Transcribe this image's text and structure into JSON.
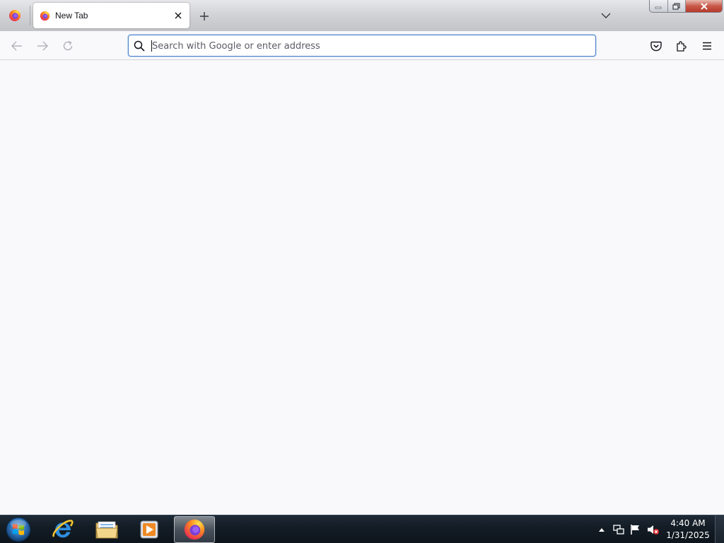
{
  "browser": {
    "tab": {
      "title": "New Tab"
    },
    "urlbar": {
      "placeholder": "Search with Google or enter address",
      "value": ""
    },
    "icons": {
      "firefox_menu": "firefox-logo-icon",
      "tab_favicon": "firefox-logo-icon",
      "tab_close": "close-icon",
      "new_tab": "plus-icon",
      "list_tabs": "chevron-down-icon",
      "back": "arrow-left-icon",
      "forward": "arrow-right-icon",
      "reload": "reload-icon",
      "search": "search-icon",
      "pocket": "pocket-icon",
      "extensions": "puzzle-icon",
      "menu": "hamburger-menu-icon"
    },
    "colors": {
      "accent": "#4f82c9",
      "content_bg": "#f9f9fb"
    }
  },
  "taskbar": {
    "apps": [
      {
        "name": "Internet Explorer",
        "icon": "internet-explorer-icon"
      },
      {
        "name": "Windows Explorer",
        "icon": "folder-icon"
      },
      {
        "name": "Windows Media Player",
        "icon": "media-player-icon"
      },
      {
        "name": "Firefox",
        "icon": "firefox-logo-icon",
        "active": true
      }
    ],
    "tray_icons": [
      "show-hidden-icons-icon",
      "network-icon",
      "action-center-flag-icon",
      "volume-muted-icon"
    ],
    "clock": {
      "time": "4:40 AM",
      "date": "1/31/2025"
    }
  }
}
